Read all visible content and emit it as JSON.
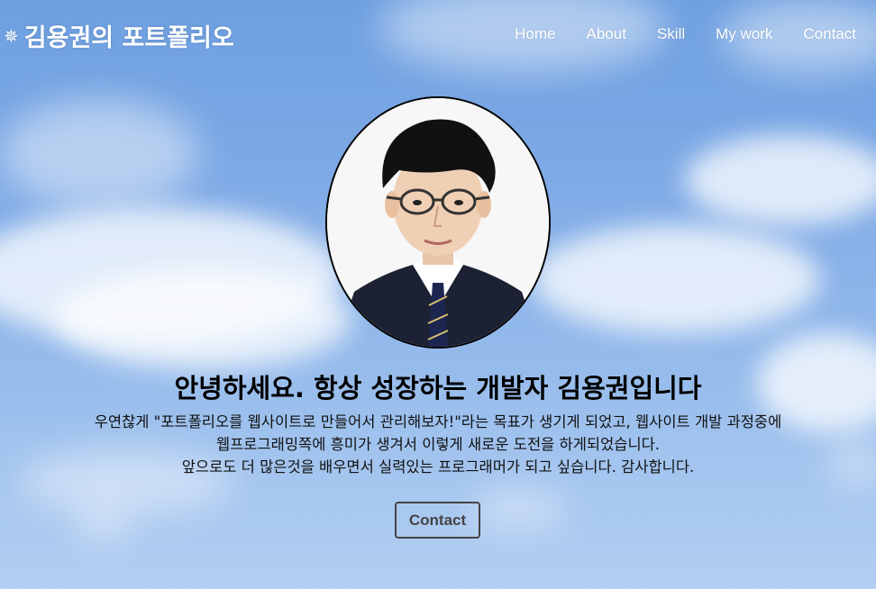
{
  "header": {
    "logo_icon": "✵",
    "logo_text": "김용권의 포트폴리오"
  },
  "nav": {
    "items": [
      {
        "label": "Home"
      },
      {
        "label": "About"
      },
      {
        "label": "Skill"
      },
      {
        "label": "My work"
      },
      {
        "label": "Contact"
      }
    ]
  },
  "hero": {
    "headline": "안녕하세요. 항상 성장하는 개발자 김용권입니다",
    "intro_lines": [
      "우연찮게 \"포트폴리오를 웹사이트로 만들어서 관리해보자!\"라는 목표가 생기게 되었고, 웹사이트 개발 과정중에",
      "웹프로그래밍쪽에 흥미가 생겨서 이렇게 새로운 도전을 하게되었습니다.",
      "앞으로도 더 많은것을 배우면서 실력있는 프로그래머가 되고 싶습니다. 감사합니다."
    ],
    "contact_button": "Contact"
  },
  "icons": {
    "logo": "gear-sun-icon"
  },
  "colors": {
    "sky": "#7eaae6",
    "text": "#000000",
    "nav_text": "#ffffff",
    "button_border": "#444444"
  }
}
